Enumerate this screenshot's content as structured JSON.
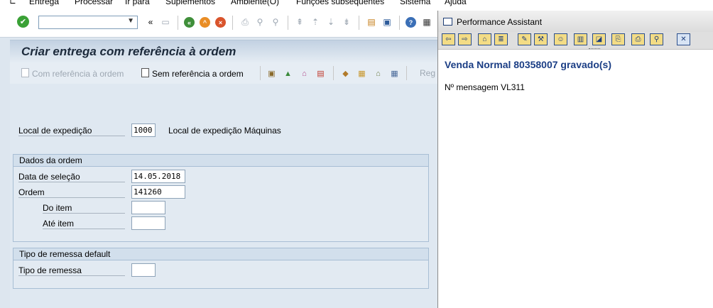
{
  "menu": {
    "entrega": "Entrega",
    "processar": "Processar",
    "ir_para": "Ir para",
    "suplementos": "Suplementos",
    "ambiente": "Ambiente(O)",
    "funcoes": "Funções subsequentes",
    "sistema": "Sistema",
    "ajuda": "Ajuda"
  },
  "toolbar": {
    "command_value": ""
  },
  "screen": {
    "title": "Criar entrega com referência à ordem",
    "btn_com_ref": "Com referência à ordem",
    "btn_sem_ref": "Sem referência a ordem",
    "btn_truncated": "Reg"
  },
  "form": {
    "local_expedicao_label": "Local de expedição",
    "local_expedicao_value": "1000",
    "local_expedicao_desc": "Local de expedição Máquinas",
    "dados_ordem_title": "Dados da ordem",
    "data_selecao_label": "Data de seleção",
    "data_selecao_value": "14.05.2018",
    "ordem_label": "Ordem",
    "ordem_value": "141260",
    "do_item_label": "Do item",
    "do_item_value": "",
    "ate_item_label": "Até item",
    "ate_item_value": "",
    "tipo_group_title": "Tipo de remessa default",
    "tipo_remessa_label": "Tipo de remessa",
    "tipo_remessa_value": ""
  },
  "assistant": {
    "title": "Performance Assistant",
    "heading": "Venda Normal 80358007 gravado(s)",
    "message": "Nº mensagem VL311"
  },
  "colors": {
    "accent": "#1b3e85",
    "ok_green": "#3aa136",
    "title_text": "#1c2a3b"
  }
}
